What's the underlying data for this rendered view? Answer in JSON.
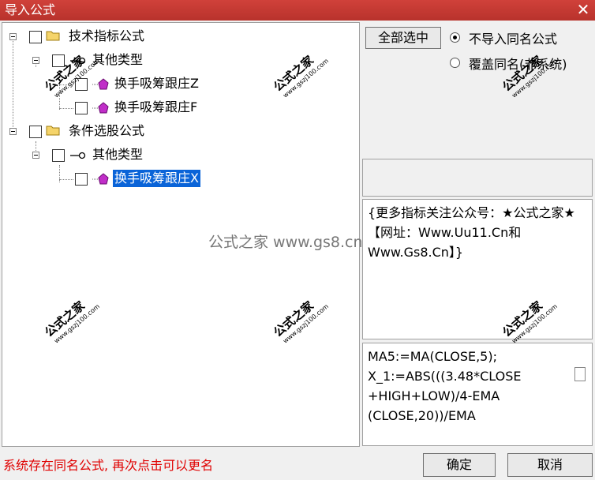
{
  "window": {
    "title": "导入公式",
    "close": "✕"
  },
  "tree": {
    "nodes": [
      {
        "label": "技术指标公式"
      },
      {
        "label": "其他类型"
      },
      {
        "label": "换手吸筹跟庄Z"
      },
      {
        "label": "换手吸筹跟庄F"
      },
      {
        "label": "条件选股公式"
      },
      {
        "label": "其他类型"
      },
      {
        "label": "换手吸筹跟庄X"
      }
    ]
  },
  "options": {
    "select_all": "全部选中",
    "radio_no_import": "不导入同名公式",
    "radio_overwrite": "覆盖同名(非系统)"
  },
  "description": {
    "text": "{更多指标关注公众号：★公式之家★ 【网址：Www.Uu11.Cn和Www.Gs8.Cn】}"
  },
  "code": {
    "lines": [
      "MA5:=MA(CLOSE,5);",
      "X_1:=ABS(((3.48*CLOSE",
      "+HIGH+LOW)/4-EMA",
      "(CLOSE,20))/EMA"
    ]
  },
  "status": "系统存在同名公式, 再次点击可以更名",
  "buttons": {
    "ok": "确定",
    "cancel": "取消"
  },
  "watermark": {
    "main": "公式之家",
    "url": "www.gszj100.com",
    "center": "公式之家 www.gs8.cn"
  },
  "colors": {
    "titlebar": "#c0392b",
    "selection": "#0a64d8",
    "status": "#e00000"
  }
}
